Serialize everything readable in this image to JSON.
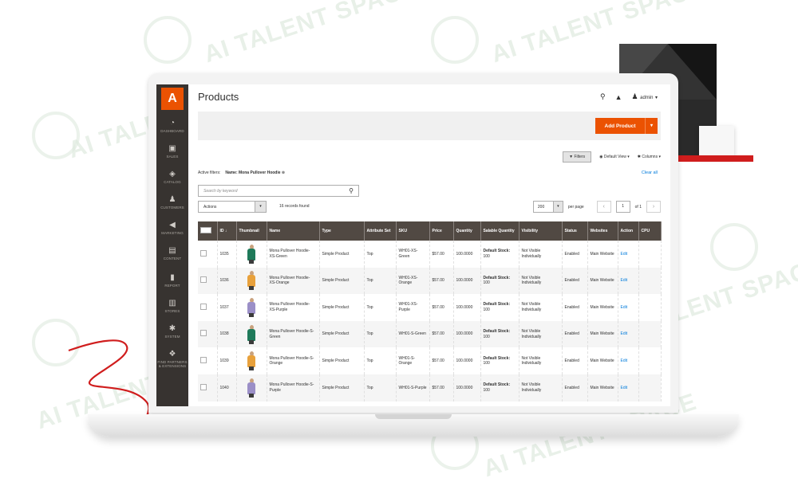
{
  "watermark": "AI TALENT SPACE",
  "header": {
    "title": "Products",
    "user": "admin"
  },
  "icons": {
    "search": "search-icon",
    "notifications": "bell-icon",
    "user": "user-icon"
  },
  "brand": {
    "logo_letter": "A",
    "accent": "#eb5202",
    "sidebar_bg": "#373330",
    "header_bg": "#514943"
  },
  "sidebar": {
    "items": [
      {
        "label": "DASHBOARD",
        "icon": "dashboard-icon"
      },
      {
        "label": "SALES",
        "icon": "dollar-icon"
      },
      {
        "label": "CATALOG",
        "icon": "cube-icon"
      },
      {
        "label": "CUSTOMERS",
        "icon": "customers-icon"
      },
      {
        "label": "MARKETING",
        "icon": "megaphone-icon"
      },
      {
        "label": "CONTENT",
        "icon": "content-icon"
      },
      {
        "label": "REPORT",
        "icon": "bar-chart-icon"
      },
      {
        "label": "STORES",
        "icon": "store-icon"
      },
      {
        "label": "SYSTEM",
        "icon": "gear-icon"
      },
      {
        "label": "FIND PARTNERS & EXTENSIONS",
        "icon": "partners-icon"
      }
    ]
  },
  "actions": {
    "add_product": "Add Product",
    "filters": "Filters",
    "default_view": "Default View",
    "columns": "Columns"
  },
  "filters": {
    "active_label": "Active filters:",
    "active_value": "Name: Mona Pullover Hoodie",
    "clear_all": "Clear all"
  },
  "search": {
    "placeholder": "Search by keyword"
  },
  "mass_actions": {
    "label": "Actions"
  },
  "records": "16 records found",
  "pager": {
    "per_page_value": "200",
    "per_page_label": "per page",
    "page": "1",
    "of": "of 1"
  },
  "table": {
    "columns": [
      "ID",
      "Thumbnail",
      "Name",
      "Type",
      "Attribute Set",
      "SKU",
      "Price",
      "Quantity",
      "Salable Quantity",
      "Visibility",
      "Status",
      "Websites",
      "Action",
      "CPU"
    ],
    "rows": [
      {
        "id": "1035",
        "name": "Mona Pullover Hoodie-XS-Green",
        "type": "Simple Product",
        "attr": "Top",
        "sku": "WH01-XS-Green",
        "price": "$57.00",
        "qty": "100.0000",
        "salable_label": "Default Stock:",
        "salable_value": "100",
        "visibility": "Not Visible Individually",
        "status": "Enabled",
        "websites": "Main Website",
        "action": "Edit",
        "color": "#1f7a5a"
      },
      {
        "id": "1036",
        "name": "Mona Pullover Hoodie-XS-Orange",
        "type": "Simple Product",
        "attr": "Top",
        "sku": "WH01-XS-Orange",
        "price": "$57.00",
        "qty": "100.0000",
        "salable_label": "Default Stock:",
        "salable_value": "100",
        "visibility": "Not Visible Individually",
        "status": "Enabled",
        "websites": "Main Website",
        "action": "Edit",
        "color": "#e8a13c"
      },
      {
        "id": "1037",
        "name": "Mona Pullover Hoodie-XS-Purple",
        "type": "Simple Product",
        "attr": "Top",
        "sku": "WH01-XS-Purple",
        "price": "$57.00",
        "qty": "100.0000",
        "salable_label": "Default Stock:",
        "salable_value": "100",
        "visibility": "Not Visible Individually",
        "status": "Enabled",
        "websites": "Main Website",
        "action": "Edit",
        "color": "#9b8fc7"
      },
      {
        "id": "1038",
        "name": "Mona Pullover Hoodie-S-Green",
        "type": "Simple Product",
        "attr": "Top",
        "sku": "WH01-S-Green",
        "price": "$57.00",
        "qty": "100.0000",
        "salable_label": "Default Stock:",
        "salable_value": "100",
        "visibility": "Not Visible Individually",
        "status": "Enabled",
        "websites": "Main Website",
        "action": "Edit",
        "color": "#1f7a5a"
      },
      {
        "id": "1039",
        "name": "Mona Pullover Hoodie-S-Orange",
        "type": "Simple Product",
        "attr": "Top",
        "sku": "WH01-S-Orange",
        "price": "$57.00",
        "qty": "100.0000",
        "salable_label": "Default Stock:",
        "salable_value": "100",
        "visibility": "Not Visible Individually",
        "status": "Enabled",
        "websites": "Main Website",
        "action": "Edit",
        "color": "#e8a13c"
      },
      {
        "id": "1040",
        "name": "Mona Pullover Hoodie-S-Purple",
        "type": "Simple Product",
        "attr": "Top",
        "sku": "WH01-S-Purple",
        "price": "$57.00",
        "qty": "100.0000",
        "salable_label": "Default Stock:",
        "salable_value": "100",
        "visibility": "Not Visible Individually",
        "status": "Enabled",
        "websites": "Main Website",
        "action": "Edit",
        "color": "#9b8fc7"
      }
    ]
  }
}
